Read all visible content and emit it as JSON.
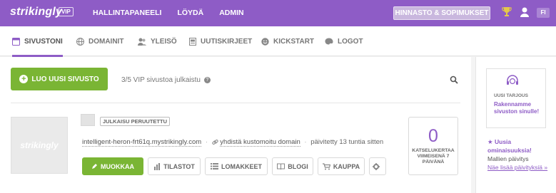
{
  "topbar": {
    "logo": "strikingly",
    "vip_badge": "VIP",
    "nav": [
      "HALLINTAPANEELI",
      "LÖYDÄ",
      "ADMIN"
    ],
    "pricing_button": "HINNASTO & SOPIMUKSET",
    "language": "FI",
    "bg_color": "#8e5cc6"
  },
  "subnav": {
    "tabs": [
      {
        "label": "SIVUSTONI",
        "icon": "browser-window-icon",
        "active": true
      },
      {
        "label": "DOMAINIT",
        "icon": "globe-icon",
        "active": false
      },
      {
        "label": "YLEISÖ",
        "icon": "users-icon",
        "active": false
      },
      {
        "label": "UUTISKIRJEET",
        "icon": "newsletter-icon",
        "active": false
      },
      {
        "label": "KICKSTART",
        "icon": "smiley-icon",
        "active": false
      },
      {
        "label": "LOGOT",
        "icon": "palette-icon",
        "active": false
      }
    ]
  },
  "main": {
    "create_button": "LUO UUSI SIVUSTO",
    "vip_count": "3/5 VIP sivustoa julkaistu",
    "help_glyph": "?"
  },
  "site": {
    "thumb_logo": "strikingly",
    "status": "JULKAISU PERUUTETTU",
    "url": "intelligent-heron-frt61q.mystrikingly.com",
    "separator": "·",
    "custom_domain": "yhdistä kustomoitu domain",
    "updated": "päivitetty 13 tuntia sitten",
    "actions": {
      "edit": "MUOKKAA",
      "stats": "TILASTOT",
      "forms": "LOMAKKEET",
      "blog": "BLOGI",
      "store": "KAUPPA"
    },
    "views_count": "0",
    "views_label": "KATSELUKERTAA VIIMEISENÄ 7 PÄIVÄNÄ"
  },
  "sidebar": {
    "offer_title": "UUSI TARJOUS",
    "offer_text": "Rakennamme sivuston sinulle!",
    "news_title": "Uusia ominaisuuksia!",
    "news_sub": "Mallien päivitys",
    "news_link": "Näe lisää päivityksiä »"
  },
  "colors": {
    "accent": "#8e5cc6",
    "green": "#7ab534"
  }
}
